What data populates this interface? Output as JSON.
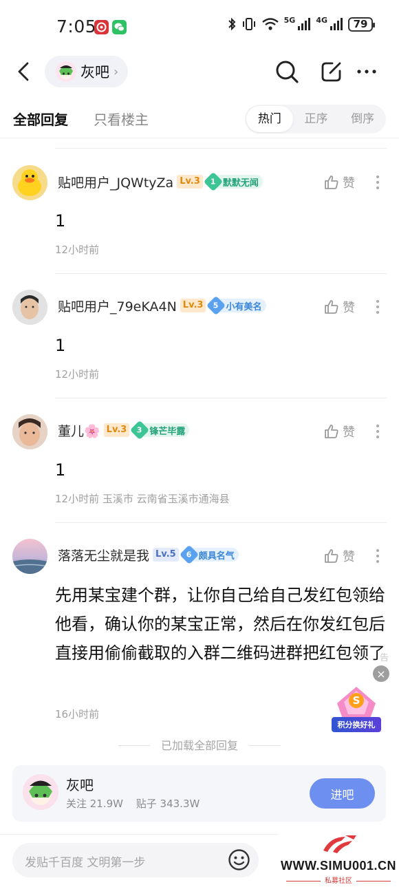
{
  "status_bar": {
    "time": "7:05",
    "network_5g": "5G",
    "network_4g": "4G",
    "battery": "79"
  },
  "header": {
    "forum_name": "灰吧",
    "chevron": "›",
    "icons": [
      "back-icon",
      "search-icon",
      "compose-icon",
      "more-icon"
    ]
  },
  "tabs": {
    "all_replies": "全部回复",
    "op_only": "只看楼主",
    "sort": [
      "热门",
      "正序",
      "倒序"
    ],
    "active_sort": "热门"
  },
  "replies": [
    {
      "username": "贴吧用户_JQWtyZa",
      "level": "Lv.3",
      "badge_num": "1",
      "badge_text": "默默无闻",
      "like_label": "赞",
      "content": "1",
      "meta": "12小时前"
    },
    {
      "username": "贴吧用户_79eKA4N",
      "level": "Lv.3",
      "badge_num": "5",
      "badge_text": "小有美名",
      "like_label": "赞",
      "content": "1",
      "meta": "12小时前"
    },
    {
      "username": "董儿🌸",
      "level": "Lv.3",
      "badge_num": "3",
      "badge_text": "锋芒毕露",
      "like_label": "赞",
      "content": "1",
      "meta": "12小时前  玉溪市  云南省玉溪市通海县"
    },
    {
      "username": "落落无尘就是我",
      "level": "Lv.5",
      "badge_num": "6",
      "badge_text": "颇具名气",
      "like_label": "赞",
      "content": "先用某宝建个群，让你自己给自己发红包领给他看，确认你的某宝正常，然后在你发红包后直接用偷偷截取的入群二维码进群把红包领了",
      "meta": "16小时前"
    }
  ],
  "ad": {
    "label": "告",
    "close": "×",
    "banner": "积分换好礼",
    "letter": "S"
  },
  "loaded_all": "已加载全部回复",
  "forum_card": {
    "name": "灰吧",
    "followers": "关注 21.9W",
    "posts": "贴子 343.3W",
    "enter_label": "进吧"
  },
  "bottom_bar": {
    "input_placeholder": "发贴千百度 文明第一步"
  },
  "watermark": {
    "site": "WWW.SIMU001.CN",
    "sub": "私募社区"
  },
  "colors": {
    "accent": "#6d8ff0",
    "level_orange": "#e0890d",
    "badge_green": "#26a37b",
    "badge_blue": "#3b86d6"
  }
}
